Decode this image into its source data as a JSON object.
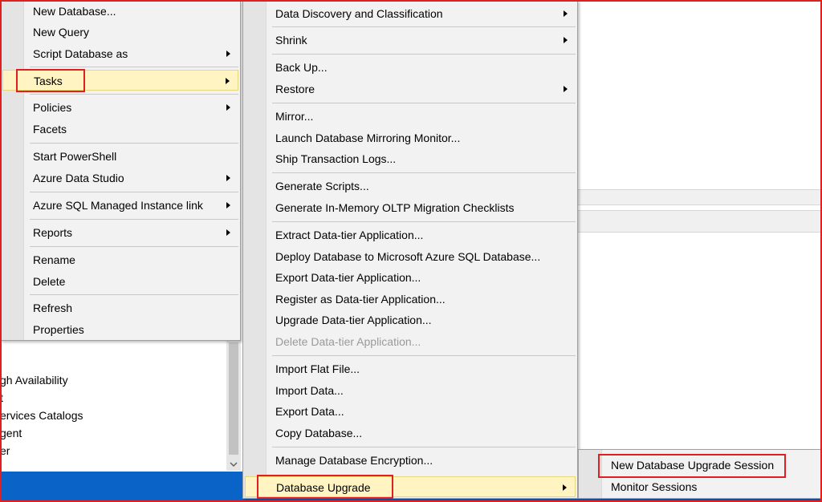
{
  "context_menu": {
    "items": [
      {
        "label": "New Database...",
        "has_submenu": false
      },
      {
        "label": "New Query",
        "has_submenu": false
      },
      {
        "label": "Script Database as",
        "has_submenu": true
      },
      {
        "label": "Tasks",
        "has_submenu": true,
        "highlighted": true
      },
      {
        "label": "Policies",
        "has_submenu": true
      },
      {
        "label": "Facets",
        "has_submenu": false
      },
      {
        "label": "Start PowerShell",
        "has_submenu": false
      },
      {
        "label": "Azure Data Studio",
        "has_submenu": true
      },
      {
        "label": "Azure SQL Managed Instance link",
        "has_submenu": true
      },
      {
        "label": "Reports",
        "has_submenu": true
      },
      {
        "label": "Rename",
        "has_submenu": false
      },
      {
        "label": "Delete",
        "has_submenu": false
      },
      {
        "label": "Refresh",
        "has_submenu": false
      },
      {
        "label": "Properties",
        "has_submenu": false
      }
    ]
  },
  "tasks_menu": {
    "items": [
      {
        "label": "Data Discovery and Classification",
        "has_submenu": true
      },
      {
        "label": "Shrink",
        "has_submenu": true
      },
      {
        "label": "Back Up...",
        "has_submenu": false
      },
      {
        "label": "Restore",
        "has_submenu": true
      },
      {
        "label": "Mirror...",
        "has_submenu": false
      },
      {
        "label": "Launch Database Mirroring Monitor...",
        "has_submenu": false
      },
      {
        "label": "Ship Transaction Logs...",
        "has_submenu": false
      },
      {
        "label": "Generate Scripts...",
        "has_submenu": false
      },
      {
        "label": "Generate In-Memory OLTP Migration Checklists",
        "has_submenu": false
      },
      {
        "label": "Extract Data-tier Application...",
        "has_submenu": false
      },
      {
        "label": "Deploy Database to Microsoft Azure SQL Database...",
        "has_submenu": false
      },
      {
        "label": "Export Data-tier Application...",
        "has_submenu": false
      },
      {
        "label": "Register as Data-tier Application...",
        "has_submenu": false
      },
      {
        "label": "Upgrade Data-tier Application...",
        "has_submenu": false
      },
      {
        "label": "Delete Data-tier Application...",
        "has_submenu": false,
        "disabled": true
      },
      {
        "label": "Import Flat File...",
        "has_submenu": false
      },
      {
        "label": "Import Data...",
        "has_submenu": false
      },
      {
        "label": "Export Data...",
        "has_submenu": false
      },
      {
        "label": "Copy Database...",
        "has_submenu": false
      },
      {
        "label": "Manage Database Encryption...",
        "has_submenu": false
      },
      {
        "label": "Database Upgrade",
        "has_submenu": true,
        "highlighted": true
      }
    ]
  },
  "upgrade_menu": {
    "items": [
      {
        "label": "New Database Upgrade Session"
      },
      {
        "label": "Monitor Sessions"
      }
    ]
  },
  "explorer_tree": {
    "items": [
      {
        "label": "gh Availability"
      },
      {
        "label": "t"
      },
      {
        "label": "ervices Catalogs"
      },
      {
        "label": "gent"
      },
      {
        "label": "er"
      }
    ]
  },
  "colors": {
    "highlight": "#fff4c2",
    "annotation_red": "#e02020",
    "taskbar_blue": "#0a64c8"
  }
}
